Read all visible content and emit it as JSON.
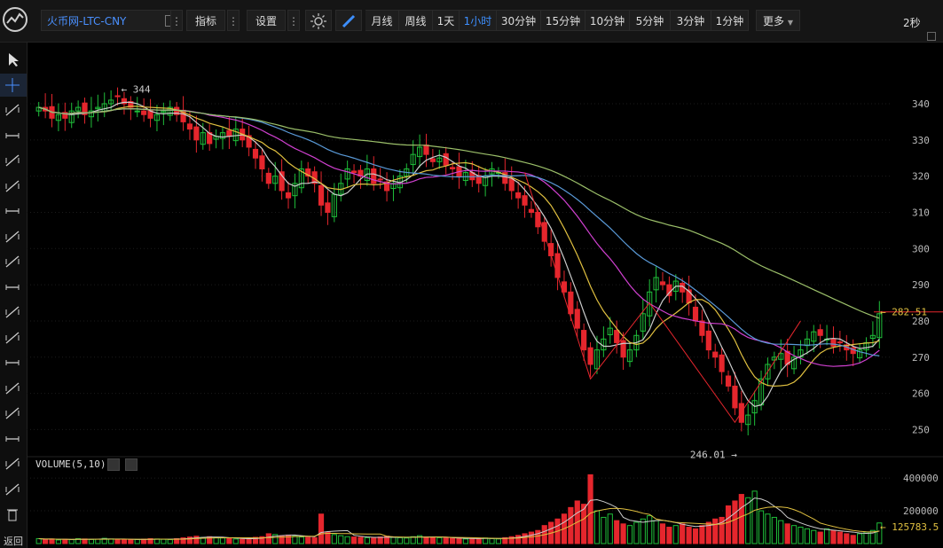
{
  "toolbar": {
    "symbol": "火币网-LTC-CNY",
    "indicators": "指标",
    "settings": "设置",
    "timeframes": [
      "月线",
      "周线",
      "1天",
      "1小时",
      "30分钟",
      "15分钟",
      "10分钟",
      "5分钟",
      "3分钟",
      "1分钟"
    ],
    "active_timeframe": "1小时",
    "more": "更多",
    "refresh": "2秒"
  },
  "sidebar": {
    "icons": [
      "cursor-icon",
      "crosshair-icon",
      "segment-icon",
      "horizontal-line-icon",
      "ray-icon",
      "vertical-line-icon",
      "ruler-icon",
      "parallel-lines-icon",
      "trend-line-icon",
      "channel-icon",
      "pitchfork-icon",
      "arrow-line-icon",
      "fan-icon",
      "gann-fan-icon",
      "fib-fan-icon",
      "speed-resistance-icon",
      "spiral-icon",
      "pattern-icon",
      "delete-icon"
    ],
    "back_label": "返回"
  },
  "colors": {
    "up": "#1fbf3a",
    "down": "#e5262d",
    "ma5": "#cccccc",
    "ma10": "#e0c040",
    "ma20": "#d040d0",
    "ma30": "#5a9ad8",
    "ma60": "#9cc06a"
  },
  "chart_data": {
    "type": "candlestick",
    "y_ticks": [
      250,
      260,
      270,
      280,
      290,
      300,
      310,
      320,
      330,
      340
    ],
    "ylim": [
      243,
      352
    ],
    "last_price": "282.51",
    "high_label": "344",
    "low_label": "246.01",
    "volume_title": "VOLUME(5,10)",
    "volume_ticks": [
      "400000",
      "200000"
    ],
    "volume_max": 460000,
    "last_volume": "125783.5",
    "closes": [
      339,
      338,
      336,
      337,
      336,
      338,
      339,
      337,
      338,
      339,
      340,
      341,
      342,
      340,
      339,
      338,
      337,
      336,
      337,
      338,
      339,
      337,
      335,
      333,
      330,
      332,
      329,
      331,
      332,
      331,
      333,
      330,
      328,
      325,
      322,
      318,
      320,
      316,
      314,
      318,
      322,
      320,
      318,
      312,
      310,
      315,
      318,
      322,
      321,
      320,
      322,
      318,
      319,
      316,
      318,
      320,
      322,
      326,
      328,
      326,
      324,
      325,
      323,
      322,
      320,
      321,
      319,
      318,
      320,
      322,
      321,
      318,
      316,
      314,
      312,
      310,
      306,
      302,
      298,
      292,
      288,
      282,
      278,
      272,
      268,
      272,
      275,
      278,
      274,
      270,
      272,
      276,
      282,
      288,
      292,
      290,
      287,
      291,
      288,
      285,
      280,
      276,
      272,
      270,
      266,
      262,
      256,
      252,
      254,
      258,
      264,
      268,
      270,
      271,
      268,
      270,
      272,
      275,
      277,
      276,
      275,
      273,
      274,
      272,
      271,
      272,
      274,
      276,
      282
    ],
    "volumes": [
      30000,
      25000,
      28000,
      22000,
      26000,
      24000,
      30000,
      28000,
      25000,
      27000,
      32000,
      28000,
      26000,
      24000,
      22000,
      25000,
      27000,
      30000,
      28000,
      26000,
      24000,
      30000,
      35000,
      40000,
      45000,
      38000,
      42000,
      36000,
      34000,
      30000,
      28000,
      26000,
      30000,
      38000,
      42000,
      60000,
      55000,
      48000,
      52000,
      45000,
      40000,
      38000,
      36000,
      180000,
      70000,
      55000,
      48000,
      42000,
      40000,
      38000,
      36000,
      34000,
      40000,
      45000,
      38000,
      36000,
      34000,
      42000,
      48000,
      40000,
      38000,
      36000,
      34000,
      32000,
      30000,
      28000,
      30000,
      32000,
      34000,
      30000,
      28000,
      36000,
      42000,
      50000,
      60000,
      70000,
      80000,
      110000,
      130000,
      150000,
      180000,
      220000,
      260000,
      240000,
      420000,
      200000,
      160000,
      180000,
      140000,
      120000,
      110000,
      130000,
      150000,
      170000,
      140000,
      120000,
      100000,
      110000,
      120000,
      100000,
      90000,
      110000,
      130000,
      150000,
      160000,
      230000,
      260000,
      300000,
      280000,
      320000,
      200000,
      180000,
      160000,
      140000,
      120000,
      110000,
      100000,
      90000,
      80000,
      70000,
      90000,
      80000,
      70000,
      60000,
      50000,
      60000,
      70000,
      80000,
      125783
    ]
  }
}
